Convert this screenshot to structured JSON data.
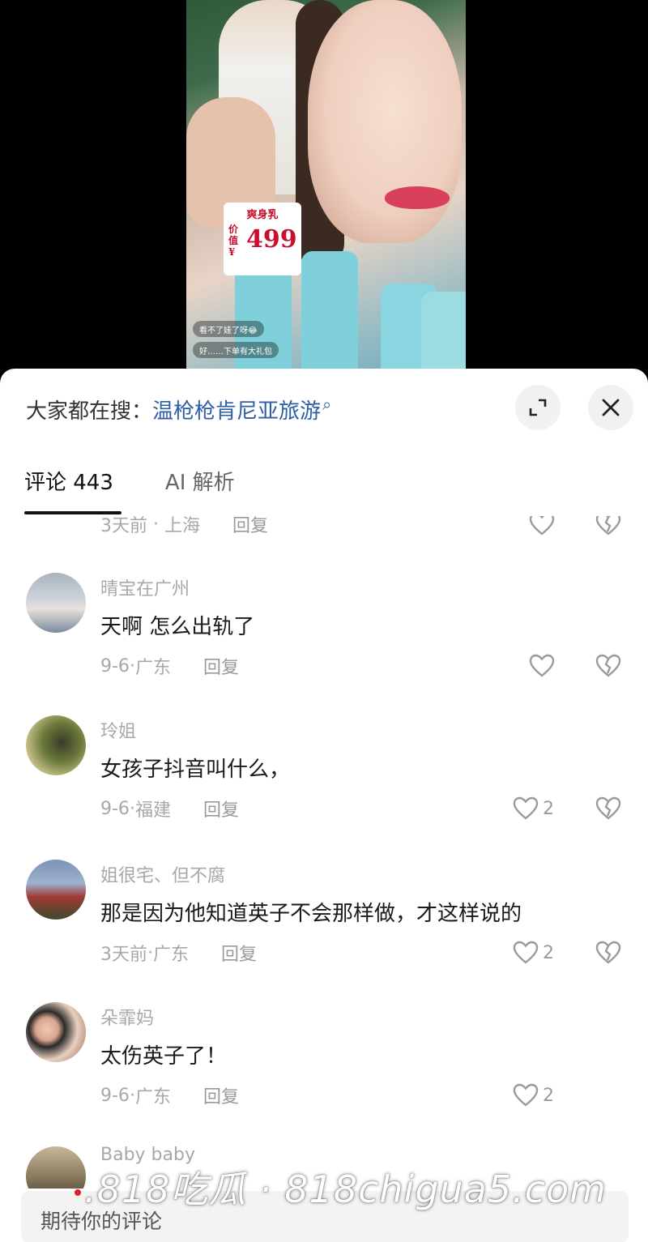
{
  "video": {
    "price_tag_title": "爽身乳",
    "price_tag_label": "价值¥",
    "price_tag_value": "499",
    "live_comments": [
      "看不了娃了呀😂",
      "好……下单有大礼包"
    ]
  },
  "header": {
    "search_prefix": "大家都在搜：",
    "search_term": "温枪枪肯尼亚旅游"
  },
  "tabs": [
    {
      "label": "评论 443"
    },
    {
      "label": "AI 解析"
    }
  ],
  "comments": [
    {
      "username": "",
      "text": "",
      "time": "3天前",
      "location": "上海",
      "reply": "回复",
      "likes": ""
    },
    {
      "username": "晴宝在广州",
      "text": "天啊 怎么出轨了",
      "time": "9-6",
      "location": "广东",
      "reply": "回复",
      "likes": ""
    },
    {
      "username": "玲姐",
      "text": "女孩子抖音叫什么，",
      "time": "9-6",
      "location": "福建",
      "reply": "回复",
      "likes": "2"
    },
    {
      "username": "姐很宅、但不腐",
      "text": "那是因为他知道英子不会那样做，才这样说的",
      "time": "3天前",
      "location": "广东",
      "reply": "回复",
      "likes": "2"
    },
    {
      "username": "朵霏妈",
      "text": "太伤英子了！",
      "time": "9-6",
      "location": "广东",
      "reply": "回复",
      "likes": "2"
    },
    {
      "username": "Baby baby",
      "text": "",
      "time": "",
      "location": "",
      "reply": "",
      "likes": ""
    }
  ],
  "input": {
    "placeholder": "期待你的评论"
  },
  "watermark": ".818吃瓜 · 818chigua5.com",
  "colors": {
    "search_term": "#2d5fa8",
    "text": "#1a1a1a",
    "meta": "#a8a8a8"
  }
}
